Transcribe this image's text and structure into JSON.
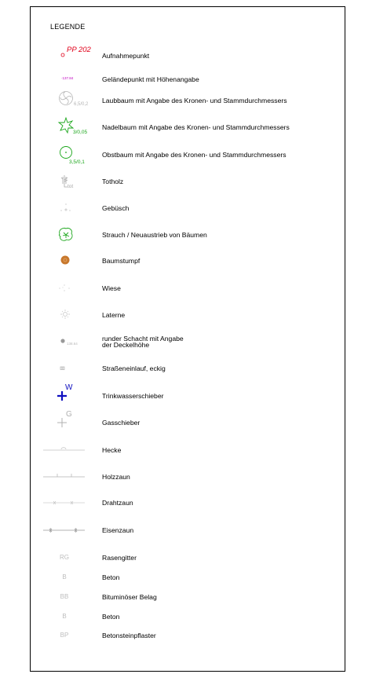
{
  "legend": {
    "title": "LEGENDE",
    "items": [
      {
        "label": "Aufnahmepunkt",
        "symbol_text": "PP 202",
        "symbol": "survey-point-icon"
      },
      {
        "label": "Geländepunkt mit Höhenangabe",
        "symbol_text": "137.84",
        "symbol": "terrain-point-icon"
      },
      {
        "label": "Laubbaum mit Angabe des Kronen- und Stammdurchmessers",
        "symbol_text": "6,5/0,2",
        "symbol": "deciduous-tree-icon"
      },
      {
        "label": "Nadelbaum mit Angabe des Kronen- und Stammdurchmessers",
        "symbol_text": "3/0,05",
        "symbol": "conifer-tree-icon"
      },
      {
        "label": "Obstbaum mit Angabe des Kronen- und Stammdurchmessers",
        "symbol_text": "3,5/0,1",
        "symbol": "fruit-tree-icon"
      },
      {
        "label": "Totholz",
        "symbol_text": "tot",
        "symbol": "deadwood-icon"
      },
      {
        "label": "Gebüsch",
        "symbol": "bush-icon"
      },
      {
        "label": "Strauch / Neuaustrieb von Bäumen",
        "symbol": "shrub-icon"
      },
      {
        "label": "Baumstumpf",
        "symbol": "tree-stump-icon"
      },
      {
        "label": "Wiese",
        "symbol": "meadow-icon"
      },
      {
        "label": "Laterne",
        "symbol": "lantern-icon"
      },
      {
        "label_lines": [
          "runder Schacht mit Angabe",
          "der Deckelhöhe"
        ],
        "symbol_text": "138.64",
        "symbol": "manhole-icon"
      },
      {
        "label": "Straßeneinlauf, eckig",
        "symbol": "street-drain-icon"
      },
      {
        "label": "Trinkwasserschieber",
        "symbol_text": "W",
        "symbol": "water-valve-icon"
      },
      {
        "label": "Gasschieber",
        "symbol_text": "G",
        "symbol": "gas-valve-icon"
      },
      {
        "label": "Hecke",
        "symbol": "hedge-line-icon"
      },
      {
        "label": "Holzzaun",
        "symbol": "wooden-fence-icon"
      },
      {
        "label": "Drahtzaun",
        "symbol": "wire-fence-icon"
      },
      {
        "label": "Eisenzaun",
        "symbol": "iron-fence-icon"
      },
      {
        "label": "Rasengitter",
        "abbr": "RG"
      },
      {
        "label": "Beton",
        "abbr": "B"
      },
      {
        "label": "Bituminöser Belag",
        "abbr": "BB"
      },
      {
        "label": "Beton",
        "abbr": "B"
      },
      {
        "label": "Betonsteinpflaster",
        "abbr": "BP"
      }
    ]
  },
  "colors": {
    "survey_point": "#e0001a",
    "terrain_point": "#c000c0",
    "conifer": "#1aa61a",
    "stump": "#c8782d",
    "water_valve": "#1010c0",
    "symbol_grey": "#9a9a9a"
  }
}
